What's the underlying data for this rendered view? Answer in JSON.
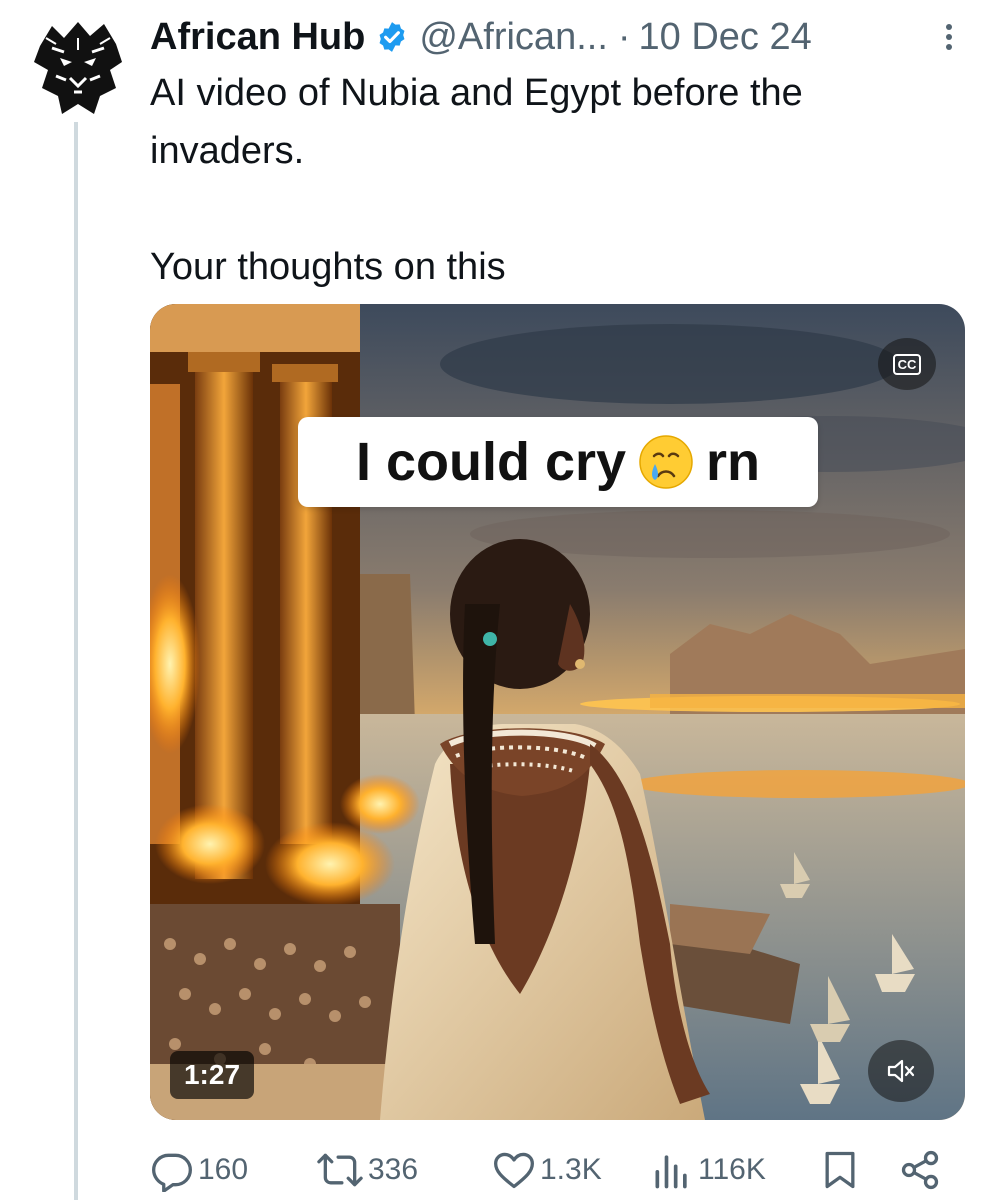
{
  "tweet": {
    "author_name": "African Hub",
    "handle": "@African...",
    "separator": "·",
    "date": "10 Dec 24",
    "text_line1": "AI video of Nubia and Egypt before the invaders.",
    "text_line2": "Your thoughts on this"
  },
  "video": {
    "caption_before": "I could cry",
    "caption_after": "rn",
    "caption_emoji": "crying-face-icon",
    "cc_label": "CC",
    "duration": "1:27",
    "muted": true
  },
  "actions": {
    "replies": "160",
    "reposts": "336",
    "likes": "1.3K",
    "views": "116K"
  },
  "colors": {
    "verified": "#1d9bf0",
    "secondary_text": "#536471",
    "thread_line": "#cfd9de"
  }
}
